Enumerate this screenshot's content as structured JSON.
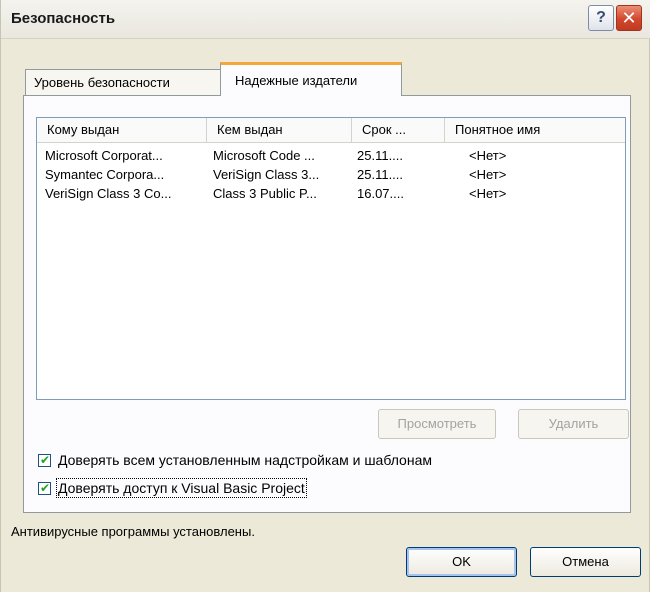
{
  "window": {
    "title": "Безопасность"
  },
  "titlebar_buttons": {
    "help": "?",
    "close": "✕"
  },
  "tabs": [
    {
      "label": "Уровень безопасности",
      "active": false
    },
    {
      "label": "Надежные издатели",
      "active": true
    }
  ],
  "list": {
    "columns": [
      "Кому выдан",
      "Кем выдан",
      "Срок ...",
      "Понятное имя"
    ],
    "rows": [
      [
        "Microsoft Corporat...",
        "Microsoft Code ...",
        "25.11....",
        "<Нет>"
      ],
      [
        "Symantec Corpora...",
        "VeriSign Class 3...",
        "25.11....",
        "<Нет>"
      ],
      [
        "VeriSign Class 3 Co...",
        "Class 3 Public P...",
        "16.07....",
        "<Нет>"
      ]
    ]
  },
  "buttons": {
    "view": "Просмотреть",
    "delete": "Удалить",
    "ok": "OK",
    "cancel": "Отмена"
  },
  "checkboxes": [
    {
      "label": "Доверять всем установленным надстройкам и шаблонам",
      "checked": true
    },
    {
      "label": "Доверять доступ к Visual Basic Project",
      "checked": true
    }
  ],
  "status": "Антивирусные программы установлены.",
  "colors": {
    "tab_highlight": "#f4a83a",
    "checkmark": "#21a121",
    "close_button": "#d2472d"
  }
}
